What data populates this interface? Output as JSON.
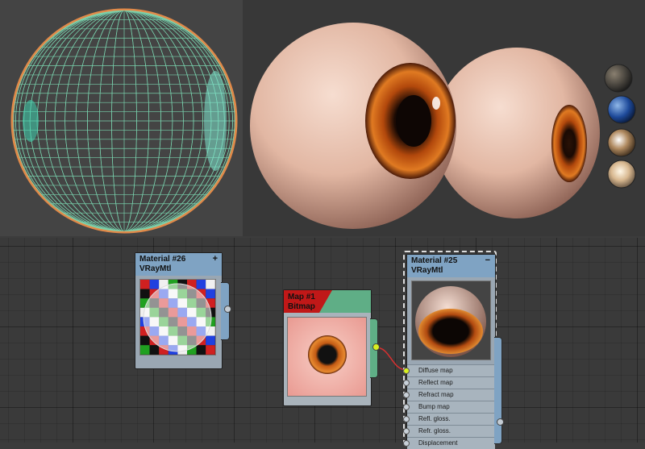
{
  "nodes": {
    "material26": {
      "title": "Material #26",
      "subtitle": "VRayMtl",
      "toggle": "+"
    },
    "map1": {
      "title": "Map #1",
      "subtitle": "Bitmap"
    },
    "material25": {
      "title": "Material #25",
      "subtitle": "VRayMtl",
      "toggle": "−",
      "slots": [
        "Diffuse map",
        "Reflect map",
        "Refract map",
        "Bump map",
        "Refl. gloss.",
        "Refr. gloss.",
        "Displacement"
      ]
    }
  },
  "colors": {
    "wire_green": "#7fe0b8",
    "wire_orange": "#e08a4a",
    "link_red": "#d83030",
    "active_socket": "#d8f020",
    "map_header": "#c01818",
    "map_tab": "#5fae86",
    "node_header": "#7fa3c3",
    "node_body": "#9aa7b3"
  },
  "icons": {
    "swatches": [
      "dark-sphere-swatch-icon",
      "blue-sphere-swatch-icon",
      "chrome-sphere-swatch-icon",
      "hdri-sphere-swatch-icon"
    ]
  }
}
